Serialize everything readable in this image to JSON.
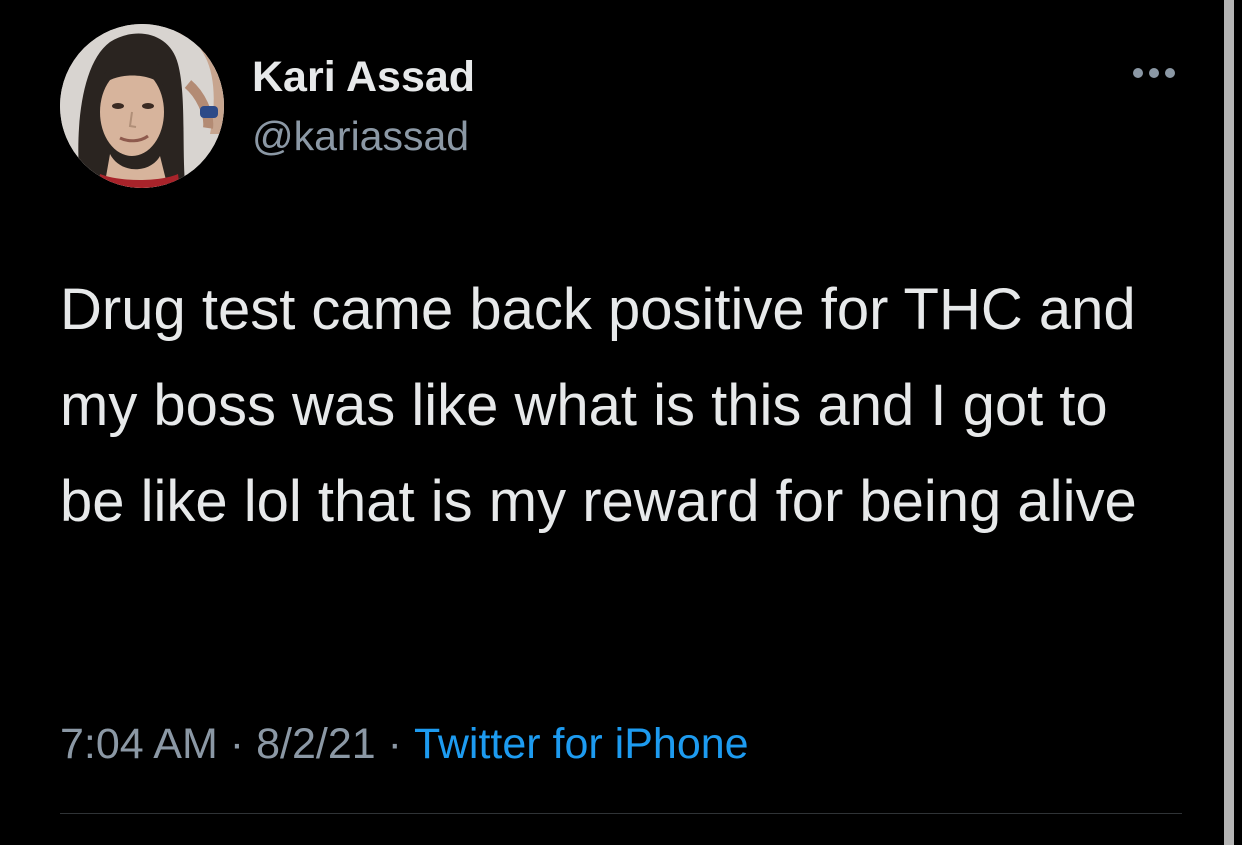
{
  "tweet": {
    "author": {
      "display_name": "Kari Assad",
      "handle": "@kariassad",
      "avatar_icon": "profile-photo"
    },
    "more_icon": "ellipsis-icon",
    "text": "Drug test came back positive for THC and my boss was like what is this and I got to be like lol that is my reward for being alive",
    "time": "7:04 AM",
    "separator": "·",
    "date": "8/2/21",
    "source": "Twitter for iPhone"
  },
  "colors": {
    "background": "#000000",
    "primary_text": "#e7e9ea",
    "secondary_text": "#8b98a5",
    "link": "#1d9bf0",
    "divider": "#2f3336",
    "scrollbar": "#b4b4b4"
  }
}
